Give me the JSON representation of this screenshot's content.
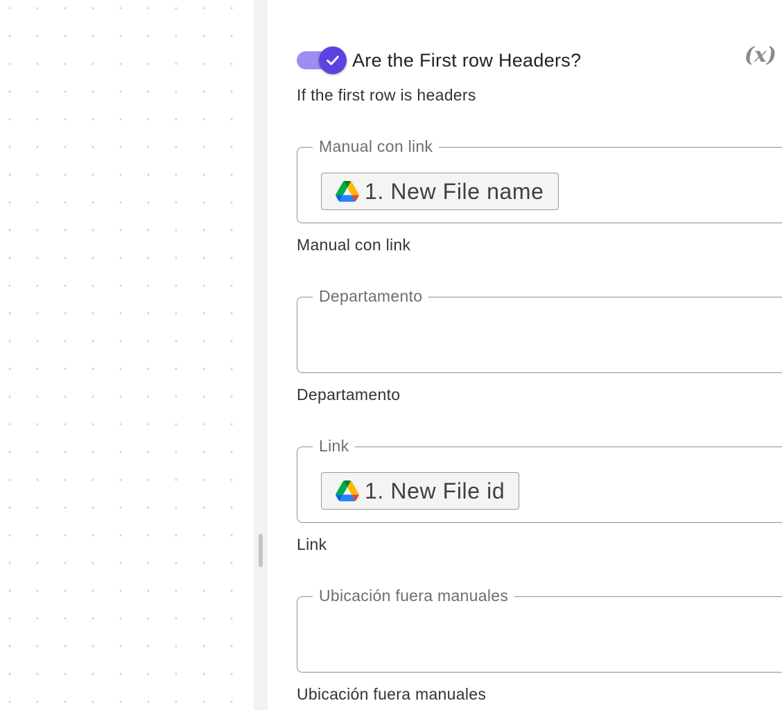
{
  "toggle": {
    "label": "Are the First row Headers?",
    "checked": true,
    "helper": "If the first row is headers",
    "track_color": "#9e8df0",
    "knob_color": "#5b43e0"
  },
  "variable_button": {
    "label": "(x)",
    "icon": "variable-icon"
  },
  "fields": [
    {
      "legend": "Manual con link",
      "chip": {
        "icon": "google-drive-icon",
        "text": "1. New File name"
      },
      "helper": "Manual con link"
    },
    {
      "legend": "Departamento",
      "chip": null,
      "helper": "Departamento"
    },
    {
      "legend": "Link",
      "chip": {
        "icon": "google-drive-icon",
        "text": "1. New File id"
      },
      "helper": "Link"
    },
    {
      "legend": "Ubicación fuera manuales",
      "chip": null,
      "helper": "Ubicación fuera manuales"
    }
  ]
}
